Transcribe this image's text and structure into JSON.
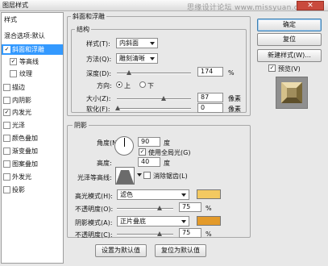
{
  "window": {
    "title": "图层样式",
    "watermark": "思缘设计论坛 www.missyuan.com",
    "close_symbol": "✕"
  },
  "sidebar": {
    "items": [
      {
        "label": "样式"
      },
      {
        "label": "混合选项:默认"
      },
      {
        "label": "斜面和浮雕",
        "checked": "✓"
      },
      {
        "label": "等高线",
        "checked": "✓"
      },
      {
        "label": "纹理",
        "checked": ""
      },
      {
        "label": "描边",
        "checked": ""
      },
      {
        "label": "内阴影",
        "checked": ""
      },
      {
        "label": "内发光",
        "checked": "✓"
      },
      {
        "label": "光泽",
        "checked": ""
      },
      {
        "label": "颜色叠加",
        "checked": ""
      },
      {
        "label": "渐变叠加",
        "checked": ""
      },
      {
        "label": "图案叠加",
        "checked": ""
      },
      {
        "label": "外发光",
        "checked": ""
      },
      {
        "label": "投影",
        "checked": ""
      }
    ]
  },
  "bevel": {
    "group_title": "斜面和浮雕",
    "structure_title": "结构",
    "style_label": "样式(T):",
    "style_value": "内斜面",
    "technique_label": "方法(Q):",
    "technique_value": "雕刻清晰",
    "depth_label": "深度(D):",
    "depth_value": "174",
    "depth_unit": "%",
    "direction_label": "方向:",
    "direction_up": "上",
    "direction_down": "下",
    "size_label": "大小(Z):",
    "size_value": "87",
    "size_unit": "像素",
    "soften_label": "软化(F):",
    "soften_value": "0",
    "soften_unit": "像素"
  },
  "shading": {
    "title": "阴影",
    "angle_label": "角度(N):",
    "angle_value": "90",
    "angle_unit": "度",
    "global_light_label": "使用全局光(G)",
    "global_light_checked": "✓",
    "altitude_label": "高度:",
    "altitude_value": "40",
    "altitude_unit": "度",
    "gloss_label": "光泽等高线:",
    "antialias_label": "消除锯齿(L)",
    "antialias_checked": "",
    "highlight_mode_label": "高光模式(H):",
    "highlight_mode_value": "滤色",
    "highlight_color": "#f3c961",
    "highlight_opacity_label": "不透明度(O):",
    "highlight_opacity_value": "75",
    "highlight_opacity_unit": "%",
    "shadow_mode_label": "阴影模式(A):",
    "shadow_mode_value": "正片叠底",
    "shadow_color": "#e39a2a",
    "shadow_opacity_label": "不透明度(C):",
    "shadow_opacity_value": "75",
    "shadow_opacity_unit": "%"
  },
  "footer": {
    "set_default": "设置为默认值",
    "reset_default": "复位为默认值"
  },
  "actions": {
    "ok": "确定",
    "reset": "复位",
    "new_style": "新建样式(W)...",
    "preview_label": "预览(V)",
    "preview_checked": "✓"
  }
}
